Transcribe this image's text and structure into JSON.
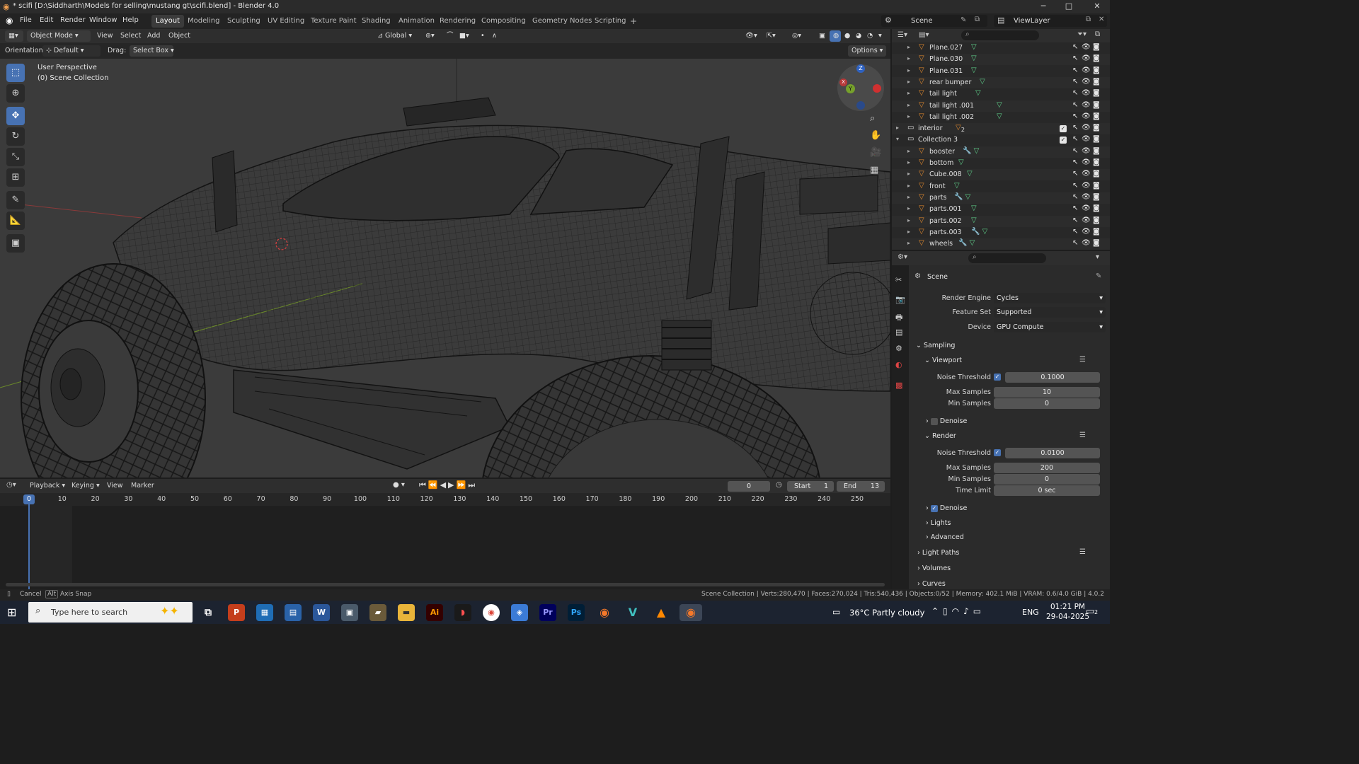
{
  "window": {
    "title": "* scifi [D:\\Siddharth\\Models for selling\\mustang gt\\scifi.blend] - Blender 4.0",
    "minimize": "─",
    "maximize": "□",
    "close": "✕"
  },
  "menus": [
    "File",
    "Edit",
    "Render",
    "Window",
    "Help"
  ],
  "workspaces": [
    "Layout",
    "Modeling",
    "Sculpting",
    "UV Editing",
    "Texture Paint",
    "Shading",
    "Animation",
    "Rendering",
    "Compositing",
    "Geometry Nodes",
    "Scripting"
  ],
  "add_workspace": "+",
  "scene": {
    "label": "Scene",
    "viewlayer": "ViewLayer"
  },
  "viewport_header": {
    "mode": "Object Mode",
    "menus": [
      "View",
      "Select",
      "Add",
      "Object"
    ],
    "transform": "Global",
    "orientation_label": "Orientation:",
    "orientation_value": "Default",
    "drag_label": "Drag:",
    "drag_value": "Select Box",
    "options": "Options"
  },
  "viewport": {
    "perspective": "User Perspective",
    "collection": "(0) Scene Collection",
    "gizmo": {
      "x": "X",
      "y": "Y",
      "z": "Z"
    }
  },
  "outliner": {
    "rows": [
      {
        "name": "Plane.027",
        "indent": 2,
        "type": "mesh",
        "checkbox": false
      },
      {
        "name": "Plane.030",
        "indent": 2,
        "type": "mesh",
        "checkbox": false
      },
      {
        "name": "Plane.031",
        "indent": 2,
        "type": "mesh",
        "checkbox": false
      },
      {
        "name": "rear bumper",
        "indent": 2,
        "type": "mesh",
        "checkbox": false
      },
      {
        "name": "tail light",
        "indent": 2,
        "type": "mesh",
        "checkbox": false
      },
      {
        "name": "tail light .001",
        "indent": 2,
        "type": "mesh",
        "checkbox": false
      },
      {
        "name": "tail light .002",
        "indent": 2,
        "type": "mesh",
        "checkbox": false
      },
      {
        "name": "interior",
        "indent": 1,
        "type": "collection",
        "checkbox": true,
        "badge": "2"
      },
      {
        "name": "Collection 3",
        "indent": 1,
        "type": "collection",
        "checkbox": true
      },
      {
        "name": "booster",
        "indent": 2,
        "type": "mesh-mod",
        "checkbox": false
      },
      {
        "name": "bottom",
        "indent": 2,
        "type": "mesh",
        "checkbox": false
      },
      {
        "name": "Cube.008",
        "indent": 2,
        "type": "mesh",
        "checkbox": false
      },
      {
        "name": "front",
        "indent": 2,
        "type": "mesh",
        "checkbox": false
      },
      {
        "name": "parts",
        "indent": 2,
        "type": "mesh-mod",
        "checkbox": false
      },
      {
        "name": "parts.001",
        "indent": 2,
        "type": "mesh",
        "checkbox": false
      },
      {
        "name": "parts.002",
        "indent": 2,
        "type": "mesh",
        "checkbox": false
      },
      {
        "name": "parts.003",
        "indent": 2,
        "type": "mesh-mod",
        "checkbox": false
      },
      {
        "name": "wheels",
        "indent": 2,
        "type": "mesh-mod",
        "checkbox": false
      }
    ]
  },
  "properties": {
    "context": "Scene",
    "render_engine_label": "Render Engine",
    "render_engine": "Cycles",
    "feature_set_label": "Feature Set",
    "feature_set": "Supported",
    "device_label": "Device",
    "device": "GPU Compute",
    "sampling": "Sampling",
    "viewport": "Viewport",
    "noise_threshold_label": "Noise Threshold",
    "vp_noise": "0.1000",
    "max_samples_label": "Max Samples",
    "vp_max": "10",
    "min_samples_label": "Min Samples",
    "vp_min": "0",
    "denoise": "Denoise",
    "render": "Render",
    "r_noise": "0.0100",
    "r_max": "200",
    "r_min": "0",
    "time_limit_label": "Time Limit",
    "time_limit": "0 sec",
    "lights": "Lights",
    "advanced": "Advanced",
    "light_paths": "Light Paths",
    "volumes": "Volumes",
    "curves": "Curves"
  },
  "timeline": {
    "menus": [
      "Playback",
      "Keying",
      "View",
      "Marker"
    ],
    "current_frame": "0",
    "start_label": "Start",
    "start": "1",
    "end_label": "End",
    "end": "13",
    "ticks": [
      "0",
      "10",
      "20",
      "30",
      "40",
      "50",
      "60",
      "70",
      "80",
      "90",
      "100",
      "110",
      "120",
      "130",
      "140",
      "150",
      "160",
      "170",
      "180",
      "190",
      "200",
      "210",
      "220",
      "230",
      "240",
      "250"
    ]
  },
  "status": {
    "cancel": "Cancel",
    "alt": "Alt",
    "axis_snap": "Axis Snap",
    "stats": "Scene Collection | Verts:280,470 | Faces:270,024 | Tris:540,436 | Objects:0/52 | Memory: 402.1 MiB | VRAM: 0.6/4.0 GiB | 4.0.2"
  },
  "taskbar": {
    "search_placeholder": "Type here to search",
    "weather": "36°C  Partly cloudy",
    "lang": "ENG",
    "time": "01:21 PM",
    "date": "29-04-2025",
    "notif": "2",
    "apps": [
      "task-view",
      "powerpoint",
      "calendar-app",
      "file-app",
      "word",
      "pictures",
      "folder-app",
      "explorer",
      "illustrator",
      "substance",
      "chrome",
      "m365",
      "premiere",
      "photoshop",
      "blender-alt",
      "vectorworks",
      "vlc",
      "blender"
    ]
  },
  "colors": {
    "accent": "#4772b3",
    "orange": "#e38a2d",
    "viewport_bg": "#3b3b3b",
    "mesh_icon": "#e38a2d",
    "data_icon": "#5fd18a"
  }
}
